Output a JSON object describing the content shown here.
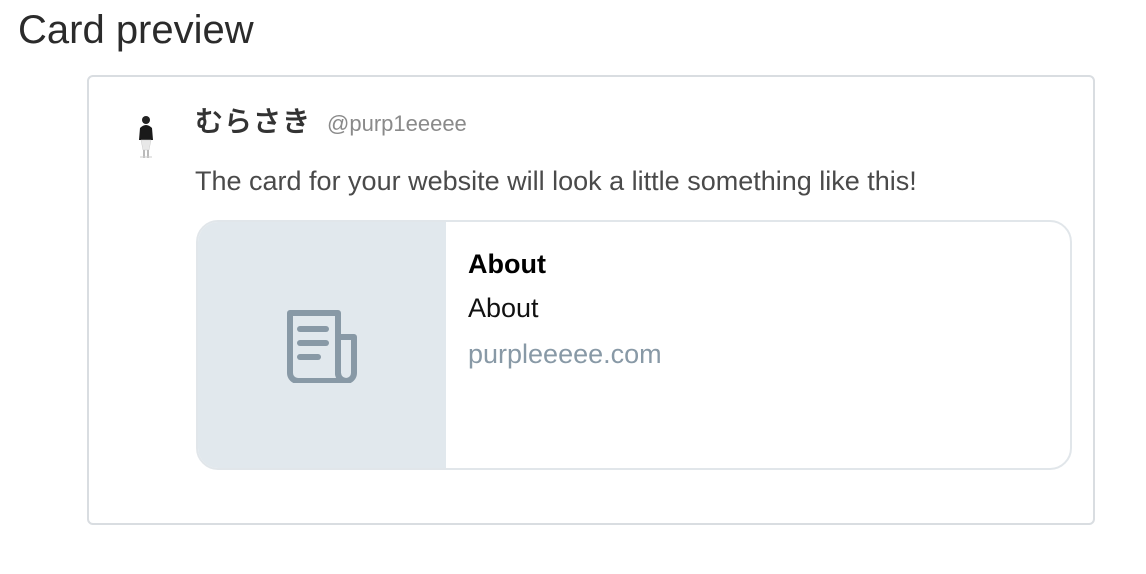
{
  "page": {
    "title": "Card preview"
  },
  "tweet": {
    "author_name": "むらさき",
    "author_handle": "@purp1eeeee",
    "text": "The card for your website will look a little something like this!"
  },
  "card": {
    "title": "About",
    "description": "About",
    "domain": "purpleeeee.com",
    "media_icon": "newspaper-icon",
    "media_bg": "#e1e8ed",
    "icon_color": "#8899a6"
  },
  "avatar": {
    "icon": "avatar"
  }
}
